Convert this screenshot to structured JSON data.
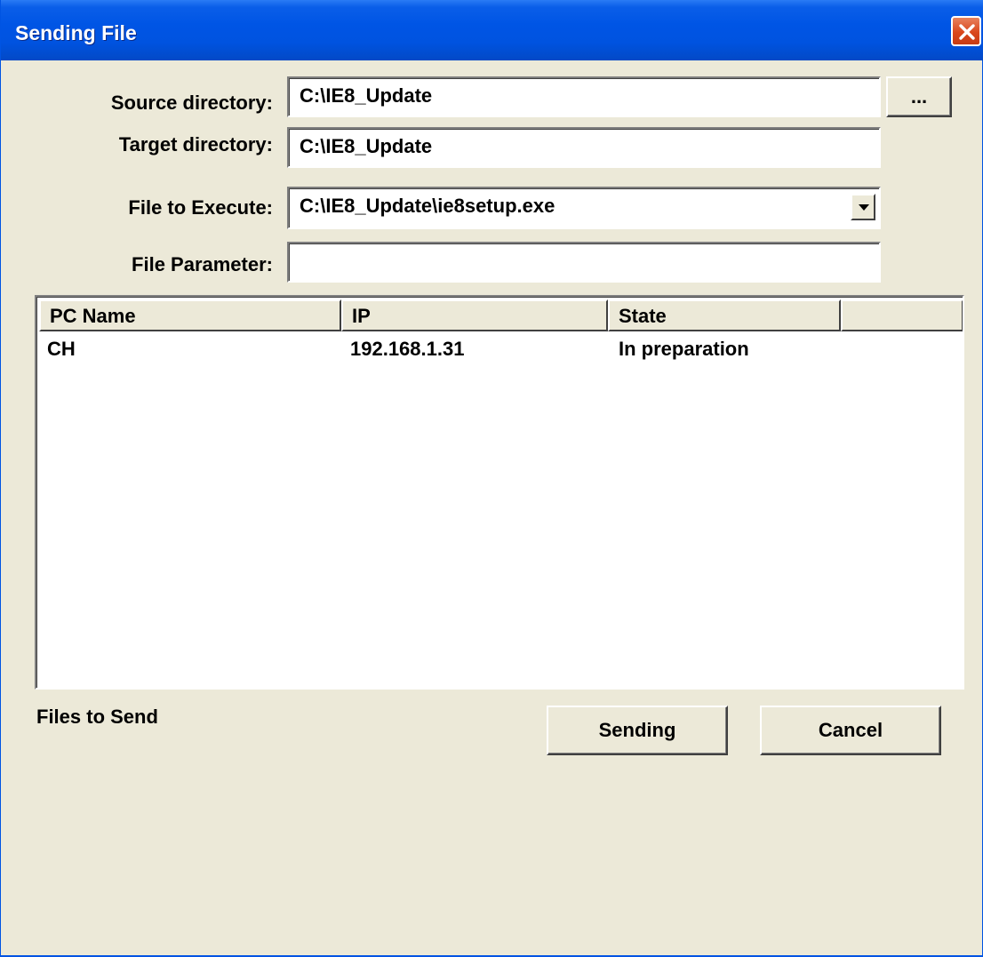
{
  "window": {
    "title": "Sending File"
  },
  "form": {
    "source_label": "Source directory:",
    "source_value": "C:\\IE8_Update",
    "browse_label": "...",
    "target_label": "Target directory:",
    "target_value": "C:\\IE8_Update",
    "execute_label": "File to Execute:",
    "execute_value": "C:\\IE8_Update\\ie8setup.exe",
    "param_label": "File Parameter:",
    "param_value": ""
  },
  "list": {
    "columns": [
      "PC Name",
      "IP",
      "State",
      ""
    ],
    "rows": [
      {
        "pc_name": "CH",
        "ip": "192.168.1.31",
        "state": "In preparation"
      }
    ]
  },
  "footer": {
    "status_text": "Files to Send",
    "send_label": "Sending",
    "cancel_label": "Cancel"
  },
  "icons": {
    "close": "close-x-icon",
    "dropdown": "chevron-down-icon"
  },
  "colors": {
    "titlebar": "#0055E5",
    "close_button": "#D9471C",
    "face": "#ECE9D8"
  }
}
